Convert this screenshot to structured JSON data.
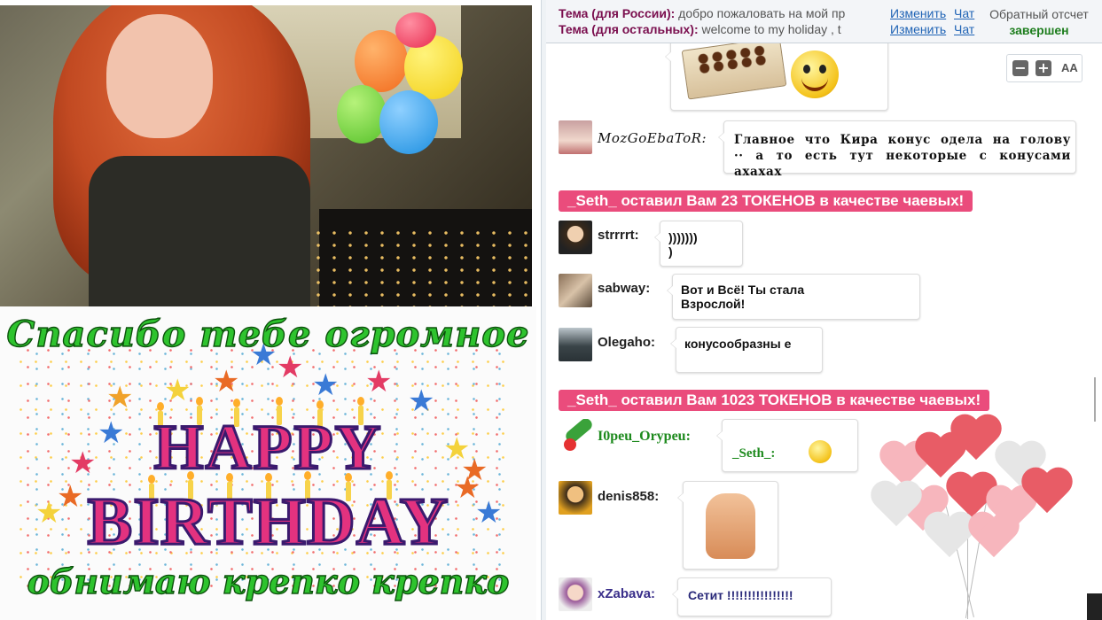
{
  "card": {
    "line_top": "Спасибо тебе огромное",
    "happy": "HAPPY",
    "birthday": "BIRTHDAY",
    "line_bottom": "обнимаю крепко крепко"
  },
  "topic": {
    "russia_label": "Тема (для России):",
    "russia_value": "добро пожаловать на мой пр",
    "others_label": "Тема (для остальных):",
    "others_value": "welcome to my holiday , t",
    "edit_label": "Изменить",
    "chat_label": "Чат"
  },
  "countdown": {
    "title": "Обратный отсчет",
    "status": "завершен"
  },
  "zoom": {
    "minus": "−",
    "plus": "+",
    "font_label": "AA"
  },
  "messages": [
    {
      "user": "MozGoEbaToR:",
      "text": "Главное что Кира конус одела на голову ·· а то есть тут некоторые с конусами ахахах"
    },
    {
      "tip": "_Seth_ оставил Вам 23 ТОКЕНОВ в качестве чаевых!"
    },
    {
      "user": "strrrrt:",
      "text": ")))))))\n)"
    },
    {
      "user": "sabway:",
      "text": "Вот и Всё! Ты стала Взрослой!"
    },
    {
      "user": "Olegaho:",
      "text": "конусообразны е"
    },
    {
      "tip": "_Seth_ оставил Вам 1023 ТОКЕНОВ в качестве чаевых!"
    },
    {
      "user": "I0peu_Orypeu:",
      "text": "_Seth_:"
    },
    {
      "user": "denis858:",
      "text": ""
    },
    {
      "user": "xZabava:",
      "text": "Сетит !!!!!!!!!!!!!!!!"
    }
  ],
  "colors": {
    "tip_bg": "#ea4c7c",
    "topic_label": "#7a0e4e",
    "link": "#1f63b5",
    "countdown_done": "#1d7d1d"
  }
}
